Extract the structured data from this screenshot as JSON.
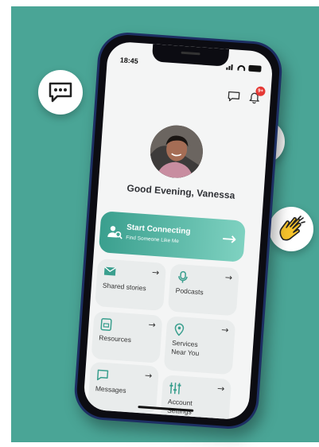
{
  "status_bar": {
    "time": "18:45"
  },
  "notifications": {
    "badge_count": "9+"
  },
  "greeting": "Good Evening, Vanessa",
  "cta": {
    "title": "Start Connecting",
    "subtitle": "Find Someone Like Me",
    "arrow": "→"
  },
  "cards": [
    {
      "label": "Shared stories",
      "icon": "chat-bubble-icon"
    },
    {
      "label": "Podcasts",
      "icon": "microphone-icon"
    },
    {
      "label": "Resources",
      "icon": "resources-icon"
    },
    {
      "label": "Services Near You",
      "icon": "location-pin-icon"
    },
    {
      "label": "Messages",
      "icon": "message-square-icon"
    },
    {
      "label": "Account Settings",
      "icon": "sliders-icon"
    }
  ],
  "card_arrow": "→",
  "colors": {
    "background": "#4aa596",
    "accent": "#3a9f8e",
    "phone_frame": "#1d2f63",
    "badge": "#e53935"
  }
}
